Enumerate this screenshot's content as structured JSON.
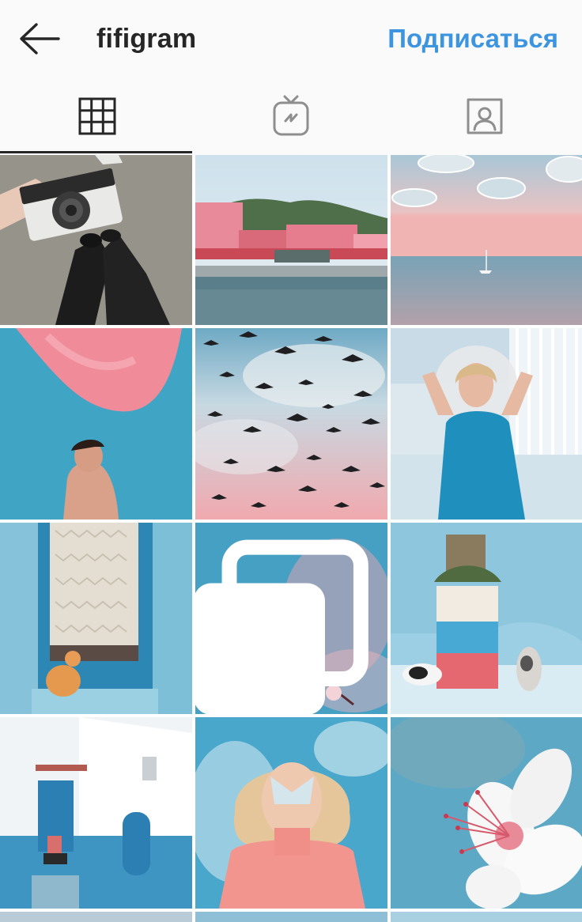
{
  "header": {
    "username": "fifigram",
    "follow_label": "Подписаться"
  },
  "icons": {
    "back": "arrow-left-icon",
    "grid": "grid-icon",
    "igtv": "igtv-icon",
    "tagged": "tagged-person-icon",
    "multi": "carousel-icon"
  },
  "colors": {
    "accent": "#3d95e0",
    "text": "#262626",
    "background": "#fafafa"
  },
  "posts": [
    "camera-feet",
    "pink-harbor",
    "sea-clouds",
    "man-pink-sky",
    "birds-pink-sky",
    "woman-blue-dress",
    "blue-doorway-cat",
    "cherry-blossom",
    "cats-painted-barrel",
    "blue-white-house",
    "woman-sweater",
    "white-flower"
  ]
}
